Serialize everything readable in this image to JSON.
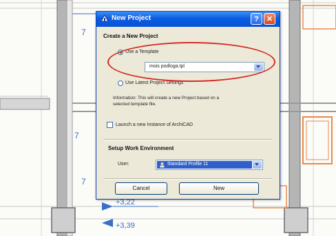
{
  "background": {
    "dimensions": [
      "7",
      "7",
      "7"
    ],
    "level_labels": [
      "+3,22",
      "+3,39"
    ],
    "colors": {
      "grid": "#9a9a9a",
      "orange": "#e9894a",
      "dim_blue": "#3a6fc4"
    }
  },
  "dialog": {
    "title": "New Project",
    "create_header": "Create a New Project",
    "use_template_label": "Use a Template",
    "template_value": "mois podloga.tpl",
    "latest_settings_label": "Use Latest Project Settings",
    "info_text_line1": "Information: This will create a new Project based on a",
    "info_text_line2": "selected template file.",
    "launch_new_instance_label": "Launch a new Instance of ArchiCAD",
    "work_env_header": "Setup Work Environment",
    "user_label": "User:",
    "user_profile_value": "Standard Profile 11",
    "cancel_label": "Cancel",
    "new_label": "New",
    "help_glyph": "?",
    "close_glyph": "✕"
  },
  "annotation": {
    "ellipse_color": "#d42a25"
  }
}
